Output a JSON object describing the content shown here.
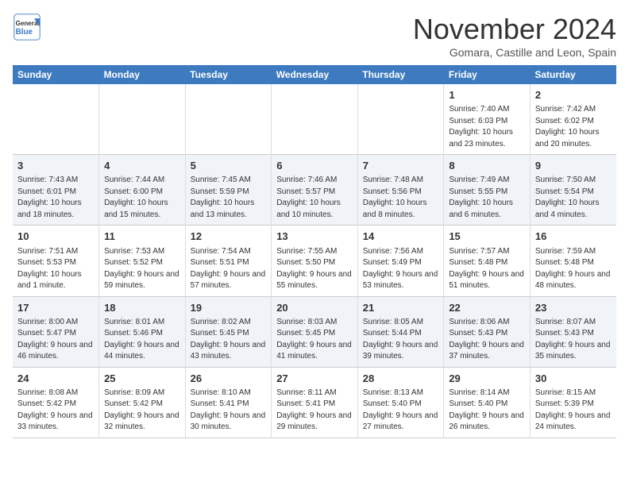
{
  "header": {
    "logo_line1": "General",
    "logo_line2": "Blue",
    "month": "November 2024",
    "location": "Gomara, Castille and Leon, Spain"
  },
  "weekdays": [
    "Sunday",
    "Monday",
    "Tuesday",
    "Wednesday",
    "Thursday",
    "Friday",
    "Saturday"
  ],
  "weeks": [
    [
      {
        "day": "",
        "info": ""
      },
      {
        "day": "",
        "info": ""
      },
      {
        "day": "",
        "info": ""
      },
      {
        "day": "",
        "info": ""
      },
      {
        "day": "",
        "info": ""
      },
      {
        "day": "1",
        "info": "Sunrise: 7:40 AM\nSunset: 6:03 PM\nDaylight: 10 hours and 23 minutes."
      },
      {
        "day": "2",
        "info": "Sunrise: 7:42 AM\nSunset: 6:02 PM\nDaylight: 10 hours and 20 minutes."
      }
    ],
    [
      {
        "day": "3",
        "info": "Sunrise: 7:43 AM\nSunset: 6:01 PM\nDaylight: 10 hours and 18 minutes."
      },
      {
        "day": "4",
        "info": "Sunrise: 7:44 AM\nSunset: 6:00 PM\nDaylight: 10 hours and 15 minutes."
      },
      {
        "day": "5",
        "info": "Sunrise: 7:45 AM\nSunset: 5:59 PM\nDaylight: 10 hours and 13 minutes."
      },
      {
        "day": "6",
        "info": "Sunrise: 7:46 AM\nSunset: 5:57 PM\nDaylight: 10 hours and 10 minutes."
      },
      {
        "day": "7",
        "info": "Sunrise: 7:48 AM\nSunset: 5:56 PM\nDaylight: 10 hours and 8 minutes."
      },
      {
        "day": "8",
        "info": "Sunrise: 7:49 AM\nSunset: 5:55 PM\nDaylight: 10 hours and 6 minutes."
      },
      {
        "day": "9",
        "info": "Sunrise: 7:50 AM\nSunset: 5:54 PM\nDaylight: 10 hours and 4 minutes."
      }
    ],
    [
      {
        "day": "10",
        "info": "Sunrise: 7:51 AM\nSunset: 5:53 PM\nDaylight: 10 hours and 1 minute."
      },
      {
        "day": "11",
        "info": "Sunrise: 7:53 AM\nSunset: 5:52 PM\nDaylight: 9 hours and 59 minutes."
      },
      {
        "day": "12",
        "info": "Sunrise: 7:54 AM\nSunset: 5:51 PM\nDaylight: 9 hours and 57 minutes."
      },
      {
        "day": "13",
        "info": "Sunrise: 7:55 AM\nSunset: 5:50 PM\nDaylight: 9 hours and 55 minutes."
      },
      {
        "day": "14",
        "info": "Sunrise: 7:56 AM\nSunset: 5:49 PM\nDaylight: 9 hours and 53 minutes."
      },
      {
        "day": "15",
        "info": "Sunrise: 7:57 AM\nSunset: 5:48 PM\nDaylight: 9 hours and 51 minutes."
      },
      {
        "day": "16",
        "info": "Sunrise: 7:59 AM\nSunset: 5:48 PM\nDaylight: 9 hours and 48 minutes."
      }
    ],
    [
      {
        "day": "17",
        "info": "Sunrise: 8:00 AM\nSunset: 5:47 PM\nDaylight: 9 hours and 46 minutes."
      },
      {
        "day": "18",
        "info": "Sunrise: 8:01 AM\nSunset: 5:46 PM\nDaylight: 9 hours and 44 minutes."
      },
      {
        "day": "19",
        "info": "Sunrise: 8:02 AM\nSunset: 5:45 PM\nDaylight: 9 hours and 43 minutes."
      },
      {
        "day": "20",
        "info": "Sunrise: 8:03 AM\nSunset: 5:45 PM\nDaylight: 9 hours and 41 minutes."
      },
      {
        "day": "21",
        "info": "Sunrise: 8:05 AM\nSunset: 5:44 PM\nDaylight: 9 hours and 39 minutes."
      },
      {
        "day": "22",
        "info": "Sunrise: 8:06 AM\nSunset: 5:43 PM\nDaylight: 9 hours and 37 minutes."
      },
      {
        "day": "23",
        "info": "Sunrise: 8:07 AM\nSunset: 5:43 PM\nDaylight: 9 hours and 35 minutes."
      }
    ],
    [
      {
        "day": "24",
        "info": "Sunrise: 8:08 AM\nSunset: 5:42 PM\nDaylight: 9 hours and 33 minutes."
      },
      {
        "day": "25",
        "info": "Sunrise: 8:09 AM\nSunset: 5:42 PM\nDaylight: 9 hours and 32 minutes."
      },
      {
        "day": "26",
        "info": "Sunrise: 8:10 AM\nSunset: 5:41 PM\nDaylight: 9 hours and 30 minutes."
      },
      {
        "day": "27",
        "info": "Sunrise: 8:11 AM\nSunset: 5:41 PM\nDaylight: 9 hours and 29 minutes."
      },
      {
        "day": "28",
        "info": "Sunrise: 8:13 AM\nSunset: 5:40 PM\nDaylight: 9 hours and 27 minutes."
      },
      {
        "day": "29",
        "info": "Sunrise: 8:14 AM\nSunset: 5:40 PM\nDaylight: 9 hours and 26 minutes."
      },
      {
        "day": "30",
        "info": "Sunrise: 8:15 AM\nSunset: 5:39 PM\nDaylight: 9 hours and 24 minutes."
      }
    ]
  ]
}
